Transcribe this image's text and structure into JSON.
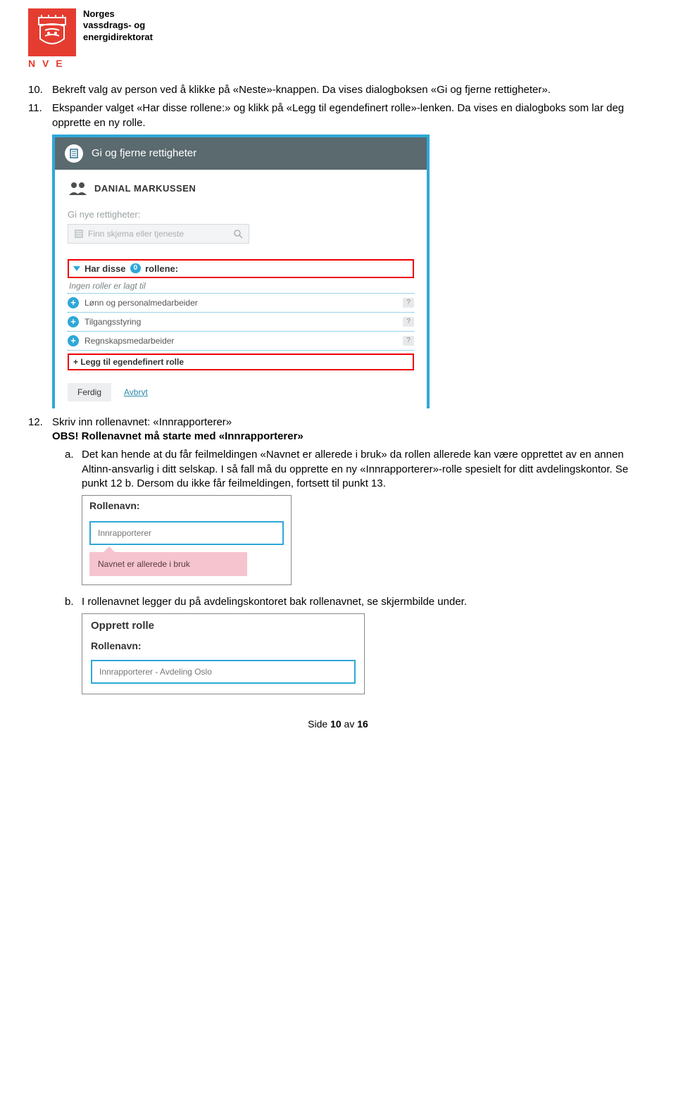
{
  "header": {
    "org_line1": "Norges",
    "org_line2": "vassdrags- og",
    "org_line3": "energidirektorat",
    "nve": "N V E"
  },
  "steps": {
    "s10": {
      "num": "10.",
      "text": "Bekreft valg av person ved å klikke på «Neste»-knappen. Da vises dialogboksen «Gi og fjerne rettigheter»."
    },
    "s11": {
      "num": "11.",
      "text": "Ekspander valget «Har disse rollene:» og klikk på «Legg til egendefinert rolle»-lenken. Da vises en dialogboks som lar deg opprette en ny rolle."
    },
    "s12": {
      "num": "12.",
      "line1": "Skriv inn rollenavnet: «Innrapporterer»",
      "obs": "OBS! Rollenavnet må starte med «Innrapporterer»"
    }
  },
  "shot1": {
    "title": "Gi og fjerne rettigheter",
    "person": "DANIAL MARKUSSEN",
    "give_label": "Gi nye rettigheter:",
    "search_placeholder": "Finn skjema eller tjeneste",
    "has_roles_pre": "Har disse",
    "has_roles_badge": "0",
    "has_roles_post": "rollene:",
    "no_roles": "Ingen roller er lagt til",
    "role1": "Lønn og personalmedarbeider",
    "role2": "Tilgangsstyring",
    "role3": "Regnskapsmedarbeider",
    "add_role": "+ Legg til egendefinert rolle",
    "btn_done": "Ferdig",
    "btn_cancel": "Avbryt"
  },
  "sub": {
    "a": {
      "letter": "a.",
      "text": "Det kan hende at du får feilmeldingen «Navnet er allerede i bruk» da rollen allerede kan være opprettet av en annen Altinn-ansvarlig i ditt selskap. I så fall må du opprette en ny «Innrapporterer»-rolle spesielt for ditt avdelingskontor. Se punkt 12 b. Dersom du ikke får feilmeldingen, fortsett til punkt 13."
    },
    "b": {
      "letter": "b.",
      "text": "I rollenavnet legger du på avdelingskontoret bak rollenavnet, se skjermbilde under."
    }
  },
  "shot2": {
    "label": "Rollenavn:",
    "value": "Innrapporterer",
    "error": "Navnet er allerede i bruk"
  },
  "shot3": {
    "heading": "Opprett rolle",
    "label": "Rollenavn:",
    "value": "Innrapporterer - Avdeling Oslo"
  },
  "footer": {
    "pre": "Side ",
    "num": "10",
    "mid": " av ",
    "total": "16"
  }
}
